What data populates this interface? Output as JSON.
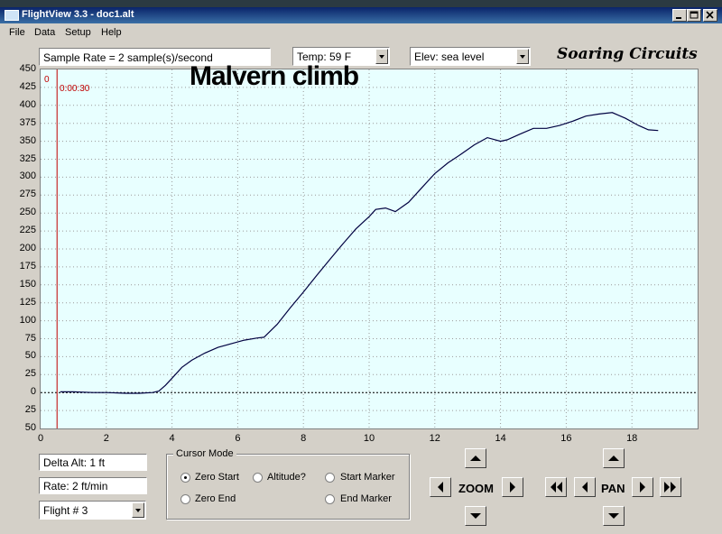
{
  "window": {
    "title": "FlightView 3.3 - doc1.alt",
    "controls": [
      "minimize-icon",
      "maximize-icon",
      "close-icon"
    ]
  },
  "menu": [
    "File",
    "Data",
    "Setup",
    "Help"
  ],
  "toolbar": {
    "sample_rate": "Sample Rate =  2 sample(s)/second",
    "temp": "Temp:  59 F",
    "elev": "Elev: sea level",
    "brand": "Soaring Circuits"
  },
  "chart_data": {
    "type": "line",
    "title": "Malvern climb",
    "xlabel": "",
    "ylabel": "",
    "xlim": [
      0,
      20
    ],
    "ylim": [
      -50,
      450
    ],
    "x_ticks": [
      "0",
      "2",
      "4",
      "6",
      "8",
      "10",
      "12",
      "14",
      "16",
      "18"
    ],
    "y_ticks": [
      "450",
      "425",
      "400",
      "375",
      "350",
      "325",
      "300",
      "275",
      "250",
      "225",
      "200",
      "175",
      "150",
      "125",
      "100",
      "75",
      "50",
      "25",
      "0",
      "25",
      "50"
    ],
    "grid": true,
    "zero_line": 0,
    "start_marker": {
      "x": 0.5,
      "label_top": "0",
      "label_time": "0:00:30"
    },
    "series": [
      {
        "name": "",
        "color": "#000040",
        "x": [
          0.6,
          1.0,
          1.6,
          2.0,
          2.6,
          3.0,
          3.4,
          3.6,
          3.8,
          4.0,
          4.3,
          4.6,
          5.0,
          5.4,
          5.8,
          6.2,
          6.6,
          6.8,
          7.2,
          7.6,
          8.0,
          8.4,
          8.8,
          9.2,
          9.6,
          10.0,
          10.2,
          10.5,
          10.8,
          11.2,
          11.6,
          12.0,
          12.4,
          12.8,
          13.2,
          13.6,
          14.0,
          14.2,
          14.6,
          15.0,
          15.4,
          15.8,
          16.2,
          16.6,
          17.0,
          17.4,
          17.8,
          18.2,
          18.5,
          18.8
        ],
        "y": [
          1,
          1,
          0,
          0,
          -1,
          -1,
          0,
          2,
          10,
          20,
          35,
          45,
          55,
          63,
          68,
          73,
          76,
          77,
          95,
          118,
          140,
          163,
          185,
          207,
          228,
          245,
          255,
          257,
          252,
          265,
          285,
          305,
          320,
          332,
          345,
          355,
          350,
          352,
          360,
          368,
          368,
          372,
          378,
          385,
          388,
          390,
          382,
          372,
          366,
          365
        ]
      }
    ]
  },
  "bottom": {
    "delta_alt": "Delta Alt: 1 ft",
    "rate": "Rate: 2 ft/min",
    "flight": "Flight # 3"
  },
  "cursor_mode": {
    "title": "Cursor Mode",
    "options": [
      "Zero Start",
      "Altitude?",
      "Start Marker",
      "Zero End",
      "End Marker"
    ],
    "selected": "Zero Start"
  },
  "nav": {
    "zoom_label": "ZOOM",
    "pan_label": "PAN"
  }
}
